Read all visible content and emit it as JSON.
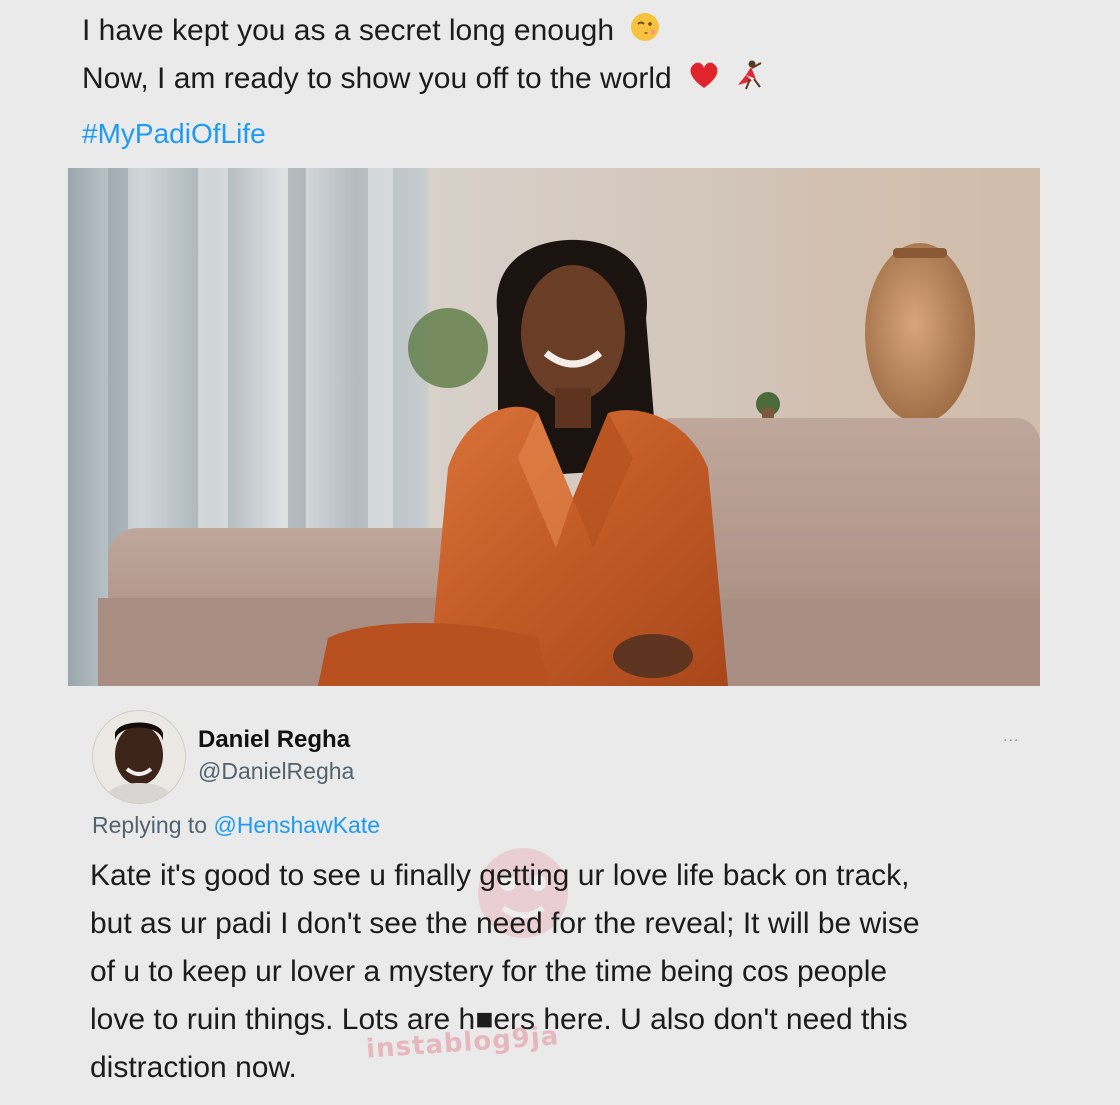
{
  "post": {
    "line1": "I have kept you as a secret long enough",
    "line2": "Now, I am ready to show you off to the world",
    "hashtag": "#MyPadiOfLife",
    "icons": [
      "winking-kiss-emoji-icon",
      "red-heart-emoji-icon",
      "dancer-emoji-icon"
    ]
  },
  "reply": {
    "name": "Daniel Regha",
    "handle": "@DanielRegha",
    "more": "...",
    "replying_prefix": "Replying to ",
    "replying_mention": "@HenshawKate",
    "lines": [
      "Kate it's good to see u finally getting ur love life back on track,",
      "but as ur padi I don't see the need for the reveal; It will be wise",
      "of u to keep ur lover a mystery for the time being cos people",
      "love to ruin things. Lots are h■ers here. U also don't need this",
      "distraction now."
    ]
  },
  "watermark": "instablog9ja",
  "colors": {
    "link": "#1d9bf0",
    "secondary_text": "#536471",
    "background": "#eaeaea"
  }
}
